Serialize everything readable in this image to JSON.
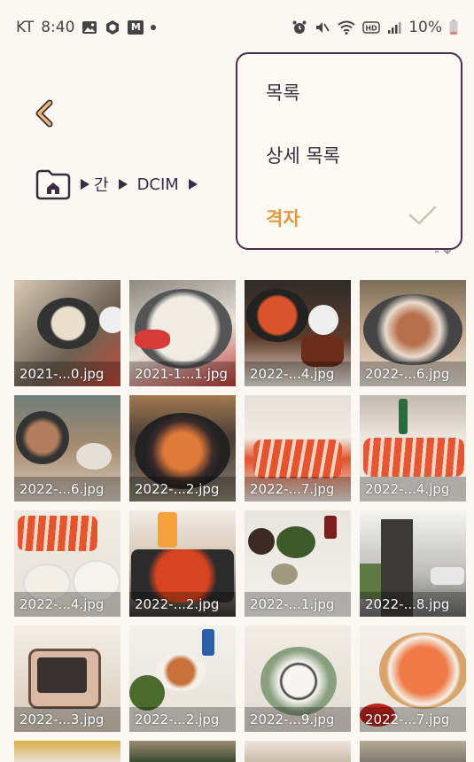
{
  "status": {
    "carrier": "KT",
    "time": "8:40",
    "battery": "10%",
    "network_icons": [
      "image-icon",
      "cube-icon",
      "m-icon",
      "dot-icon"
    ],
    "system_icons": [
      "alarm-icon",
      "mute-icon",
      "wifi-icon",
      "hd-icon",
      "signal-icon",
      "battery-icon"
    ]
  },
  "breadcrumb": {
    "partial": "간",
    "folder": "DCIM"
  },
  "menu": {
    "items": [
      {
        "label": "목록"
      },
      {
        "label": "상세 목록"
      },
      {
        "label": "격자",
        "selected": true
      }
    ]
  },
  "files": [
    {
      "name": "2021-...0.jpg"
    },
    {
      "name": "2021-1...1.jpg"
    },
    {
      "name": "2022-...4.jpg"
    },
    {
      "name": "2022-...6.jpg"
    },
    {
      "name": "2022-...6.jpg"
    },
    {
      "name": "2022-...2.jpg"
    },
    {
      "name": "2022-...7.jpg"
    },
    {
      "name": "2022-...4.jpg"
    },
    {
      "name": "2022-...4.jpg"
    },
    {
      "name": "2022-...2.jpg"
    },
    {
      "name": "2022-...1.jpg"
    },
    {
      "name": "2022-...8.jpg"
    },
    {
      "name": "2022-...3.jpg"
    },
    {
      "name": "2022-...2.jpg"
    },
    {
      "name": "2022-...9.jpg"
    },
    {
      "name": "2022-...7.jpg"
    }
  ],
  "colors": {
    "accent": "#e29a3f",
    "menu_border": "#4a2f4f",
    "background": "#fbf8f4"
  }
}
